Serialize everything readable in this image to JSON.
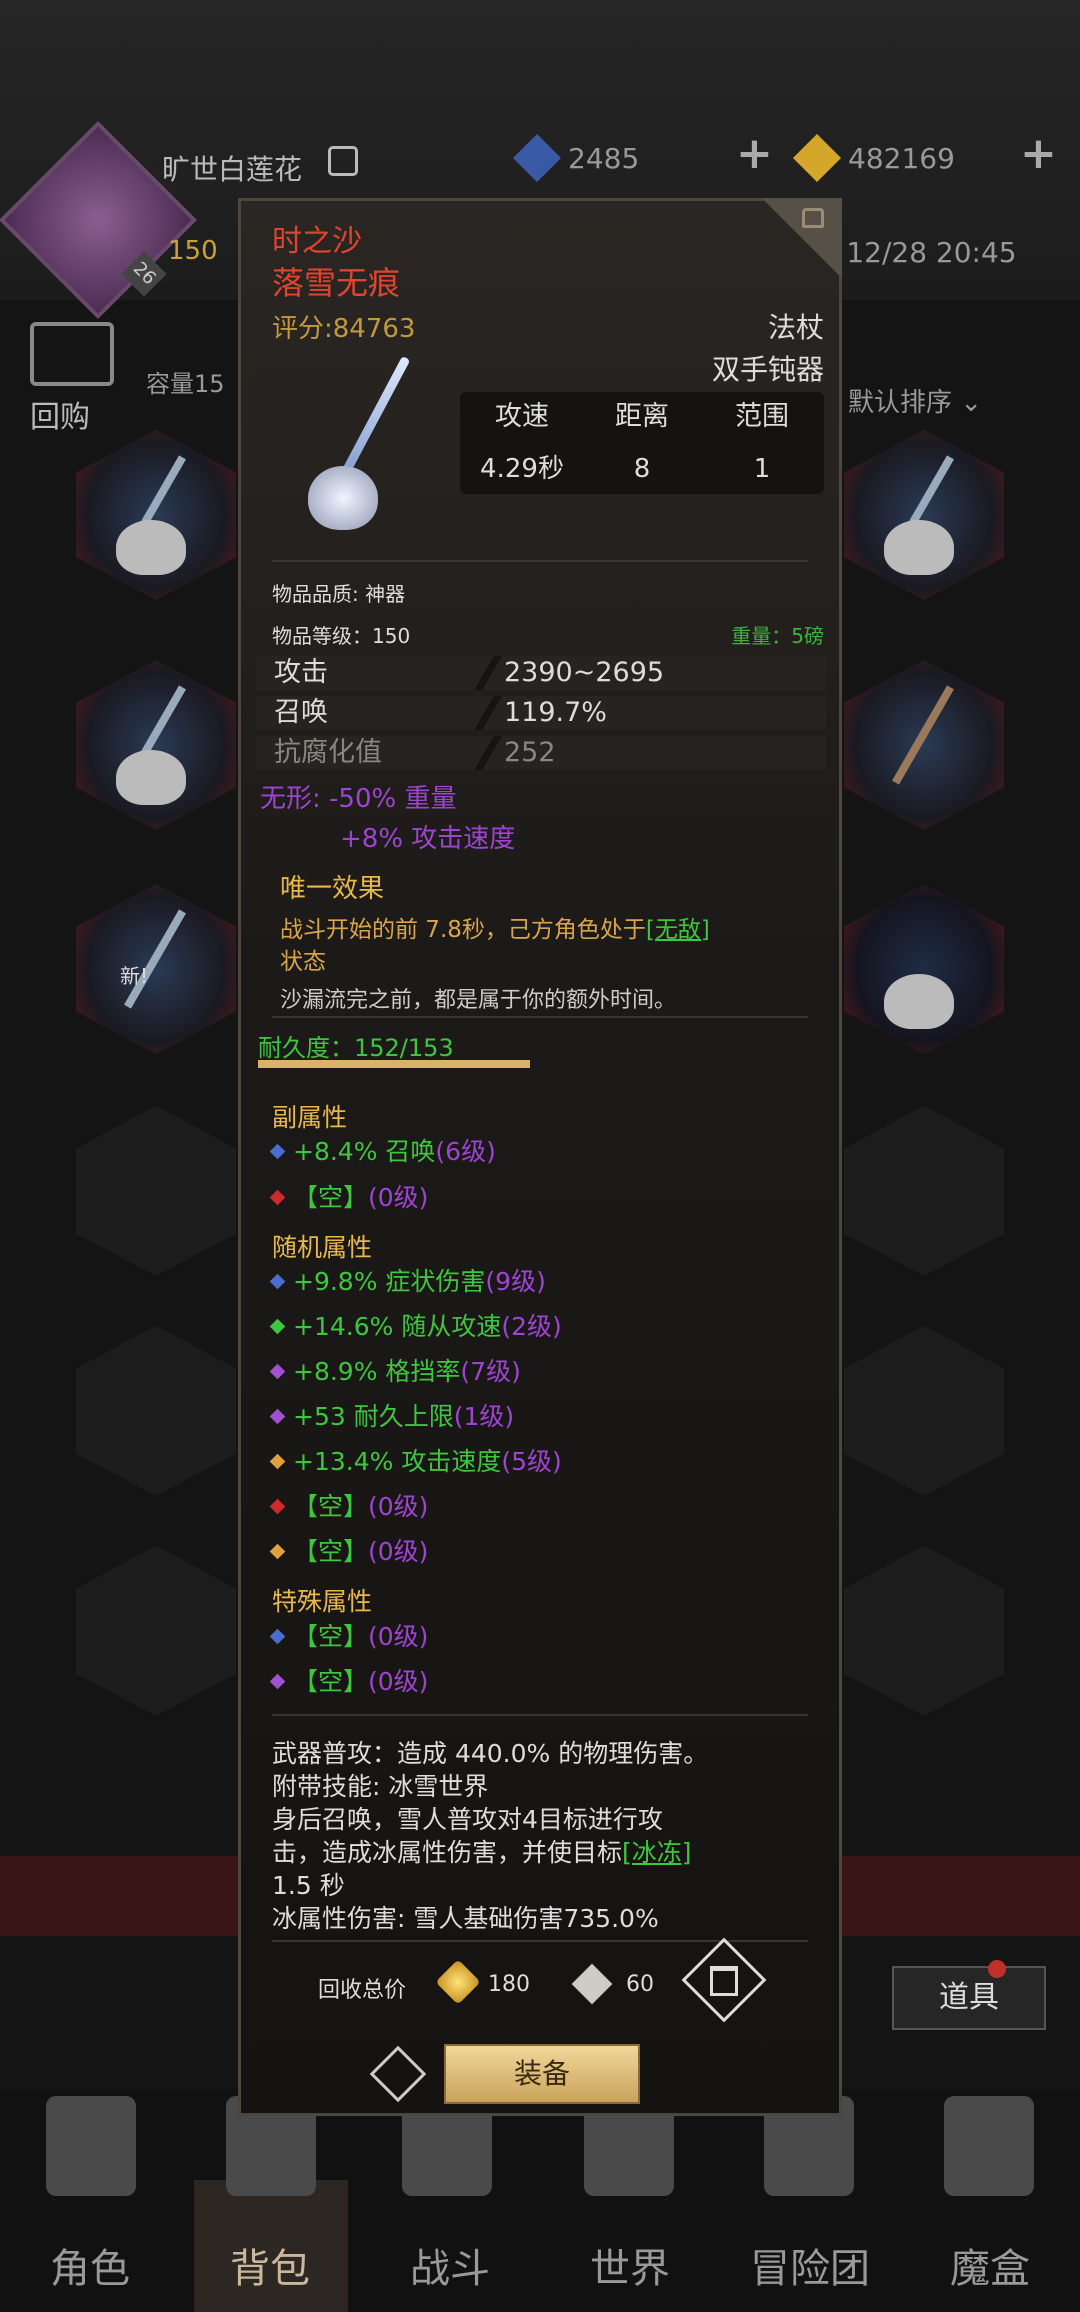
{
  "hud": {
    "player_name": "旷世白莲花",
    "level": "26",
    "xp_text": "150",
    "currency_blue": "2485",
    "currency_gold": "482169",
    "time_text": ": 12/28 20:45"
  },
  "bag": {
    "buyback_label": "回购",
    "capacity_label": "容量15",
    "sort_label": "默认排序",
    "new_tag": "新!"
  },
  "item": {
    "name": "时之沙",
    "subtitle": "落雪无痕",
    "score": "评分:84763",
    "weapon_type": "法杖",
    "weapon_subtype": "双手钝器",
    "stats_table": {
      "headers": [
        "攻速",
        "距离",
        "范围"
      ],
      "values": [
        "4.29秒",
        "8",
        "1"
      ]
    },
    "quality": "物品品质: 神器",
    "item_level": "物品等级：150",
    "weight": "重量：5磅",
    "main_stats": [
      {
        "key": "攻击",
        "value": "2390~2695"
      },
      {
        "key": "召唤",
        "value": "119.7%"
      },
      {
        "key": "抗腐化值",
        "value": "252"
      }
    ],
    "invisible_line1": "无形: -50% 重量",
    "invisible_line2": "+8% 攻击速度",
    "unique_title": "唯一效果",
    "unique_desc_a": "战斗开始的前 7.8秒，己方角色处于",
    "unique_desc_link": "[无敌]",
    "unique_desc_b": "状态",
    "flavor": "沙漏流完之前，都是属于你的额外时间。",
    "durability": "耐久度：152/153",
    "durability_fraction": 0.993,
    "secondary_title": "副属性",
    "secondary": [
      {
        "text": "+8.4% 召唤",
        "level": "(6级)",
        "gem": "#4a6ed0"
      },
      {
        "text": "【空】",
        "level": "(0级)",
        "gem": "#d02a2a"
      }
    ],
    "random_title": "随机属性",
    "random": [
      {
        "text": "+9.8% 症状伤害",
        "level": "(9级)",
        "gem": "#4a6ed0"
      },
      {
        "text": "+14.6% 随从攻速",
        "level": "(2级)",
        "gem": "#3fc63f"
      },
      {
        "text": "+8.9% 格挡率",
        "level": "(7级)",
        "gem": "#a050d0"
      },
      {
        "text": "+53 耐久上限",
        "level": "(1级)",
        "gem": "#a050d0"
      },
      {
        "text": "+13.4% 攻击速度",
        "level": "(5级)",
        "gem": "#e0a040"
      },
      {
        "text": "【空】",
        "level": "(0级)",
        "gem": "#d02a2a"
      },
      {
        "text": "【空】",
        "level": "(0级)",
        "gem": "#e0a040"
      }
    ],
    "special_title": "特殊属性",
    "special": [
      {
        "text": "【空】",
        "level": "(0级)",
        "gem": "#4a6ed0"
      },
      {
        "text": "【空】",
        "level": "(0级)",
        "gem": "#a050d0"
      }
    ],
    "desc_lines": [
      "武器普攻：造成 440.0% 的物理伤害。",
      "附带技能: 冰雪世界",
      "身后召唤，雪人普攻对4目标进行攻",
      "1.5 秒",
      "冰属性伤害: 雪人基础伤害735.0%"
    ],
    "desc_line4_a": "击，造成冰属性伤害，并使目标",
    "desc_line4_link": "[冰冻]",
    "sell_label": "回收总价",
    "sell_gold": "180",
    "sell_crystal": "60",
    "equip_label": "装备"
  },
  "right_buttons": {
    "props": "道具"
  },
  "nav": {
    "items": [
      "角色",
      "背包",
      "战斗",
      "世界",
      "冒险团",
      "魔盒"
    ]
  },
  "colors": {
    "legend_red": "#e0442e",
    "gold": "#c29a3c",
    "green": "#3fc63f",
    "purple": "#9f44d0"
  },
  "icons": [
    "edit-icon",
    "plus-icon",
    "lock-icon",
    "trash-icon",
    "share-icon",
    "cart-icon"
  ]
}
